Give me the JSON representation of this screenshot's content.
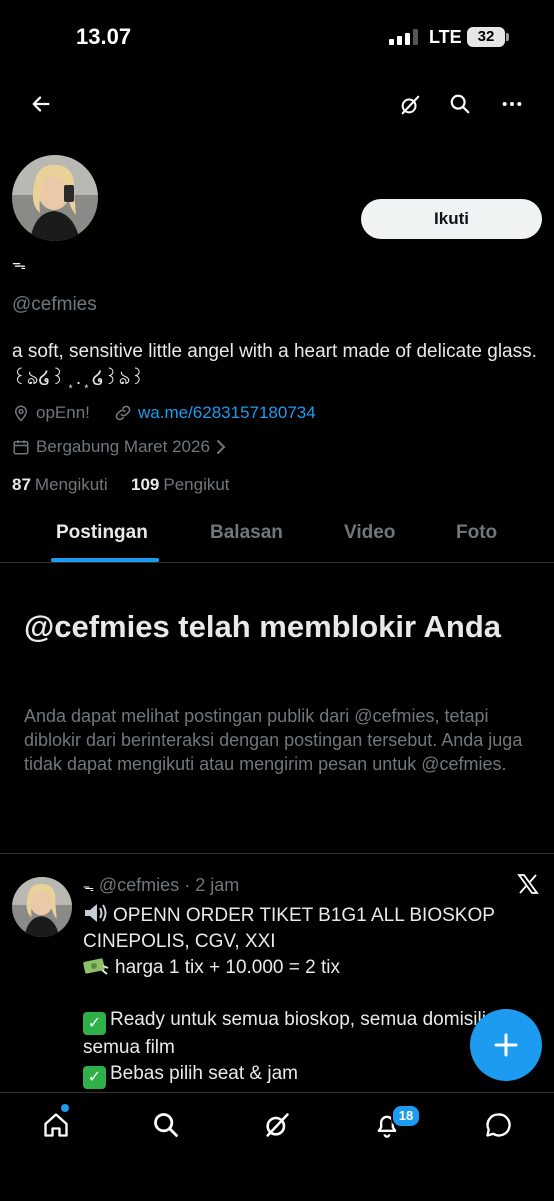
{
  "status_bar": {
    "time": "13.07",
    "network": "LTE",
    "battery": "32"
  },
  "profile": {
    "display_name": "ᯓ",
    "handle": "@cefmies",
    "follow_label": "Ikuti",
    "bio": "a soft, sensitive little angel with a heart made of delicate glass. ꒰ঌ໒꒱ ͙ . ͙ ໒꒱ঌ꒱",
    "location": "opEnn!",
    "website": "wa.me/6283157180734",
    "joined": "Bergabung Maret 2026",
    "following_count": "87",
    "following_label": "Mengikuti",
    "followers_count": "109",
    "followers_label": "Pengikut"
  },
  "tabs": [
    {
      "label": "Postingan",
      "active": true
    },
    {
      "label": "Balasan",
      "active": false
    },
    {
      "label": "Video",
      "active": false
    },
    {
      "label": "Foto",
      "active": false
    }
  ],
  "blocked": {
    "title": "@cefmies telah memblokir Anda",
    "body": "Anda dapat melihat postingan publik dari @cefmies, tetapi diblokir dari berinteraksi dengan postingan tersebut. Anda juga tidak dapat mengikuti atau mengirim pesan untuk @cefmies."
  },
  "post": {
    "author": "@cefmies",
    "time": "2 jam",
    "line1": "OPENN ORDER TIKET B1G1 ALL BIOSKOP CINEPOLIS, CGV, XXI",
    "line2": "harga 1 tix + 10.000 = 2 tix",
    "line3": "Ready untuk semua bioskop, semua domisili semua film",
    "line4": "Bebas pilih seat & jam"
  },
  "bottom_nav": {
    "notifications_badge": "18"
  },
  "colors": {
    "accent": "#1d9bf0",
    "background": "#000000",
    "muted": "#71767b",
    "text": "#e7e9ea"
  }
}
